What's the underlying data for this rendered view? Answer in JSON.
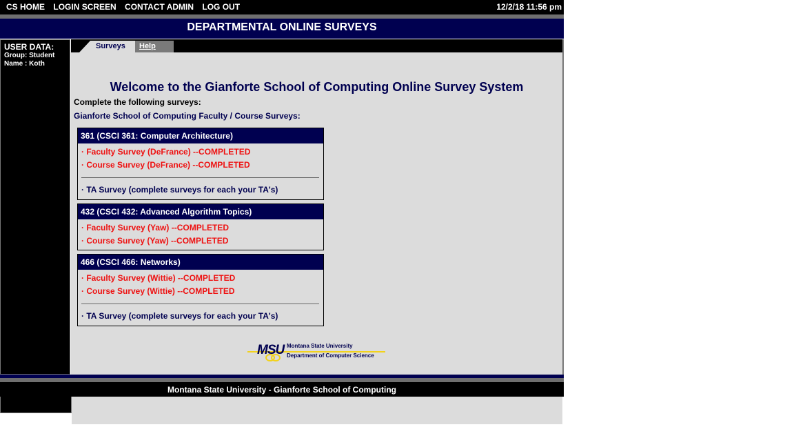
{
  "topnav": {
    "links": [
      "CS HOME",
      "LOGIN SCREEN",
      "CONTACT ADMIN",
      "LOG OUT"
    ],
    "datetime": "12/2/18 11:56 pm"
  },
  "header": {
    "title": "DEPARTMENTAL ONLINE SURVEYS"
  },
  "user": {
    "heading": "USER DATA:",
    "group": "Group: Student",
    "name": "Name : Koth"
  },
  "tabs": {
    "surveys": "Surveys",
    "help": "Help"
  },
  "main": {
    "welcome": "Welcome to the Gianforte School of Computing Online Survey System",
    "instructions": "Complete the following surveys:",
    "section_title": "Gianforte School of Computing Faculty / Course Surveys:",
    "courses": [
      {
        "header": "361   (CSCI 361: Computer Architecture)",
        "faculty": "· Faculty Survey  (DeFrance) --COMPLETED",
        "course": "· Course Survey (DeFrance) --COMPLETED",
        "ta": "· TA Survey (complete surveys for each your TA's)"
      },
      {
        "header": "432   (CSCI 432: Advanced Algorithm Topics)",
        "faculty": "· Faculty Survey  (Yaw) --COMPLETED",
        "course": "· Course Survey (Yaw) --COMPLETED"
      },
      {
        "header": "466   (CSCI 466: Networks)",
        "faculty": "· Faculty Survey  (Wittie) --COMPLETED",
        "course": "· Course Survey (Wittie) --COMPLETED",
        "ta": "· TA Survey (complete surveys for each your TA's)"
      }
    ]
  },
  "logo": {
    "abbr": "MSU",
    "line1": "Montana State University",
    "line2": "Department of Computer Science"
  },
  "footer": {
    "text": "Montana State University - Gianforte School of Computing"
  },
  "colors": {
    "navy": "#000050",
    "completed_red": "#ee1111",
    "panel_grey": "#dcdcdc"
  }
}
